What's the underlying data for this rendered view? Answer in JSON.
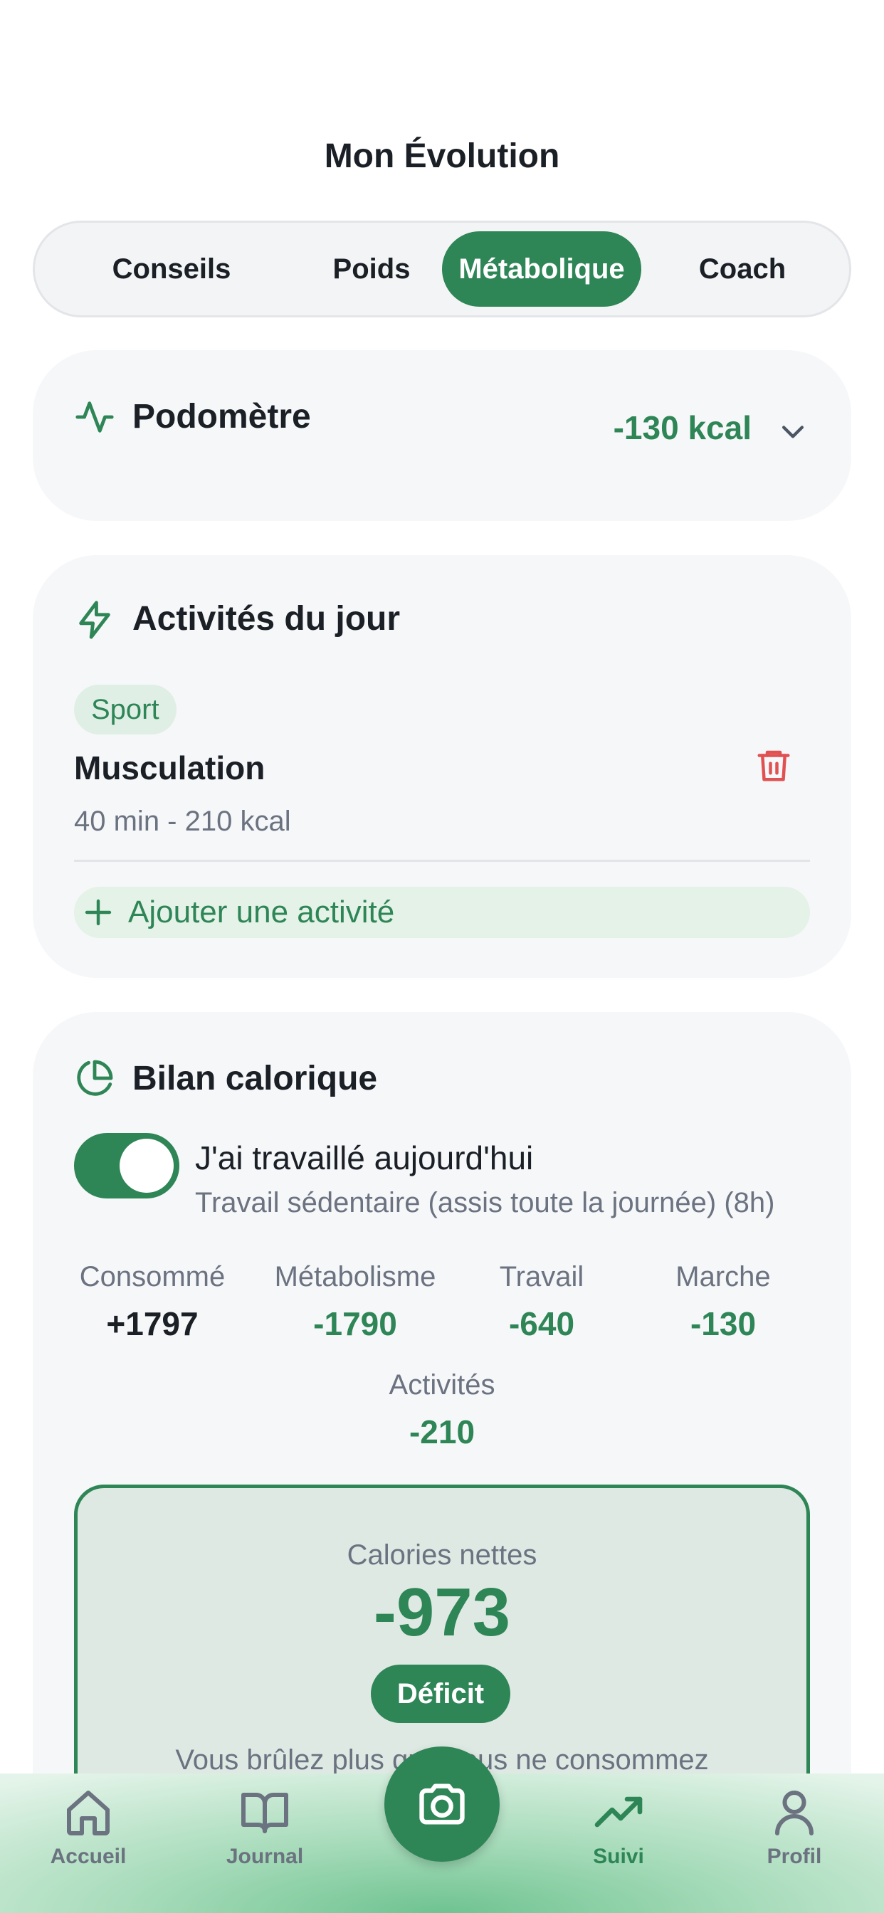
{
  "header": {
    "title": "Mon Évolution"
  },
  "tabs": [
    {
      "label": "Conseils",
      "active": false
    },
    {
      "label": "Poids",
      "active": false
    },
    {
      "label": "Métabolique",
      "active": true
    },
    {
      "label": "Coach",
      "active": false
    }
  ],
  "pedometer": {
    "title": "Podomètre",
    "value": "-130 kcal"
  },
  "activities": {
    "title": "Activités du jour",
    "items": [
      {
        "category": "Sport",
        "name": "Musculation",
        "details": "40 min - 210 kcal"
      }
    ],
    "add_label": "Ajouter une activité"
  },
  "balance": {
    "title": "Bilan calorique",
    "work_toggle": {
      "on": true,
      "label": "J'ai travaillé aujourd'hui",
      "detail": "Travail sédentaire (assis toute la journée) (8h)"
    },
    "stats": [
      {
        "label": "Consommé",
        "value": "+1797"
      },
      {
        "label": "Métabolisme",
        "value": "-1790"
      },
      {
        "label": "Travail",
        "value": "-640"
      },
      {
        "label": "Marche",
        "value": "-130"
      },
      {
        "label": "Activités",
        "value": "-210"
      }
    ],
    "net": {
      "label": "Calories nettes",
      "value": "-973",
      "status": "Déficit",
      "message": "Vous brûlez plus que vous ne consommez"
    }
  },
  "bottom_nav": {
    "items": [
      {
        "label": "Accueil",
        "icon": "home-icon",
        "active": false
      },
      {
        "label": "Journal",
        "icon": "book-icon",
        "active": false
      },
      {
        "label": "Suivi",
        "icon": "trending-up-icon",
        "active": true
      },
      {
        "label": "Profil",
        "icon": "user-icon",
        "active": false
      }
    ],
    "center_action_icon": "camera-icon"
  },
  "colors": {
    "accent": "#2e8556",
    "danger": "#e05252",
    "muted_text": "#6b7280",
    "card_bg": "#f6f7f9"
  }
}
